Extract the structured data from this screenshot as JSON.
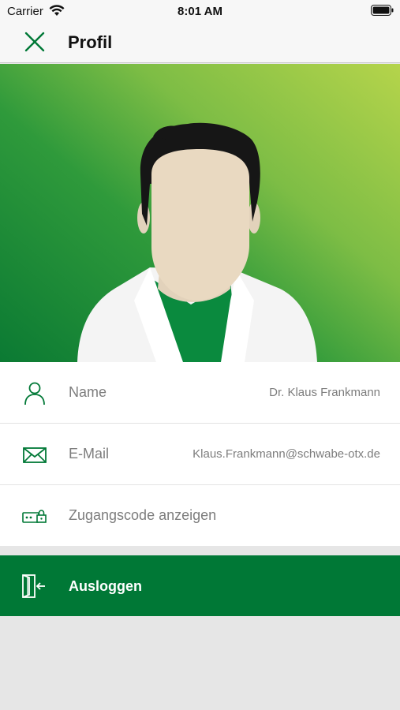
{
  "status_bar": {
    "carrier": "Carrier",
    "time": "8:01 AM"
  },
  "nav": {
    "title": "Profil",
    "close_icon": "close-icon"
  },
  "colors": {
    "brand_green": "#007836",
    "accent_light_green": "#b5d44b",
    "label_gray": "#7d7d7d"
  },
  "profile": {
    "rows": [
      {
        "icon": "user-icon",
        "label": "Name",
        "value": "Dr. Klaus Frankmann"
      },
      {
        "icon": "mail-icon",
        "label": "E-Mail",
        "value": "Klaus.Frankmann@schwabe-otx.de"
      },
      {
        "icon": "access-code-icon",
        "label": "Zugangscode anzeigen",
        "value": ""
      }
    ]
  },
  "logout": {
    "icon": "logout-icon",
    "label": "Ausloggen"
  }
}
